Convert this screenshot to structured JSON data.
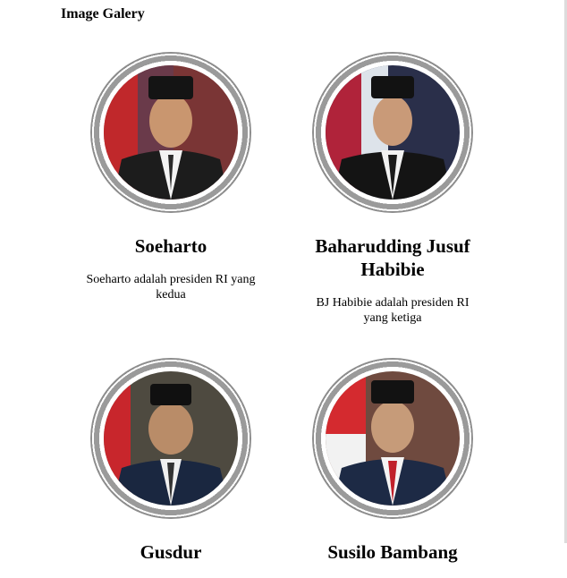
{
  "page": {
    "title": "Image Galery"
  },
  "gallery": [
    {
      "name": "Soeharto",
      "description": "Soeharto adalah presiden RI yang kedua",
      "background": "#7a3535",
      "flag": true
    },
    {
      "name": "Baharudding Jusuf Habibie",
      "description": "BJ Habibie adalah presiden RI yang ketiga",
      "background": "#2a2f4a",
      "flag": true
    },
    {
      "name": "Gusdur",
      "description": "",
      "background": "#4e4a40",
      "flag": true
    },
    {
      "name": "Susilo Bambang",
      "description": "",
      "background": "#6f4a3f",
      "flag": true
    }
  ]
}
